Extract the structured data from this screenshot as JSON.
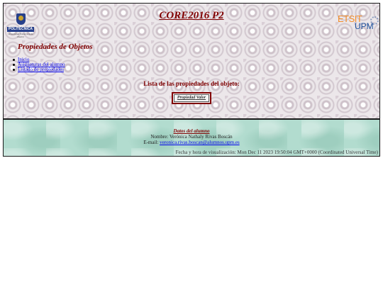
{
  "header": {
    "title": "CORE2016 P2",
    "left_logo": {
      "name": "POLITÉCNICA",
      "subtitle": "Universidad Politécnica de Madrid"
    },
    "right_logo": {
      "etsit": "ETSIT",
      "upm": "UPM"
    }
  },
  "page": {
    "section_title": "Propiedades de Objetos",
    "list_title": "Lista de las propiedades del objeto:"
  },
  "nav": {
    "items": [
      {
        "label": "Inicio"
      },
      {
        "label": "Asignaturas del alumno"
      },
      {
        "label": "Listado de propiedades"
      }
    ]
  },
  "property_table": {
    "headers": [
      "Propiedad",
      "Valor"
    ]
  },
  "footer": {
    "title": "Datos del alumno",
    "name_label": "Nombre:",
    "name_value": "Verónica Nathaly Rivas Boscán",
    "email_label": "E-mail:",
    "email_value": "veronica.rivas.boscan@alumnos.upm.es",
    "timestamp": "Fecha y hora de visualización: Mon Dec 11 2023 19:50:04 GMT+0000 (Coordinated Universal Time)"
  },
  "colors": {
    "title": "#800000",
    "link": "#0000ee",
    "footer_bg": "#b2dccf",
    "etsit_orange": "#f28c28",
    "upm_blue": "#1b4f9c"
  }
}
